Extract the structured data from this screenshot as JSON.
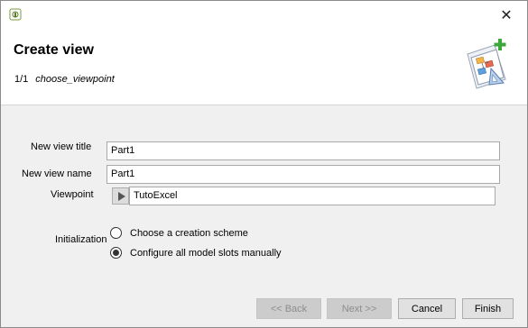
{
  "titlebar": {
    "close_glyph": "✕"
  },
  "header": {
    "title": "Create view",
    "step": "1/1",
    "step_desc": "choose_viewpoint"
  },
  "form": {
    "view_title_label": "New view title",
    "view_title_value": "Part1",
    "view_name_label": "New view name",
    "view_name_value": "Part1",
    "viewpoint_label": "Viewpoint",
    "viewpoint_value": "TutoExcel",
    "init_label": "Initialization",
    "options": [
      {
        "label": "Choose a creation scheme",
        "checked": false
      },
      {
        "label": "Configure all model slots manually",
        "checked": true
      }
    ]
  },
  "buttons": {
    "back": "<< Back",
    "next": "Next >>",
    "cancel": "Cancel",
    "finish": "Finish"
  },
  "icons": {
    "app": "app-logo-icon",
    "banner": "create-view-wizard-icon",
    "viewpoint_button": "play-triangle-icon"
  }
}
